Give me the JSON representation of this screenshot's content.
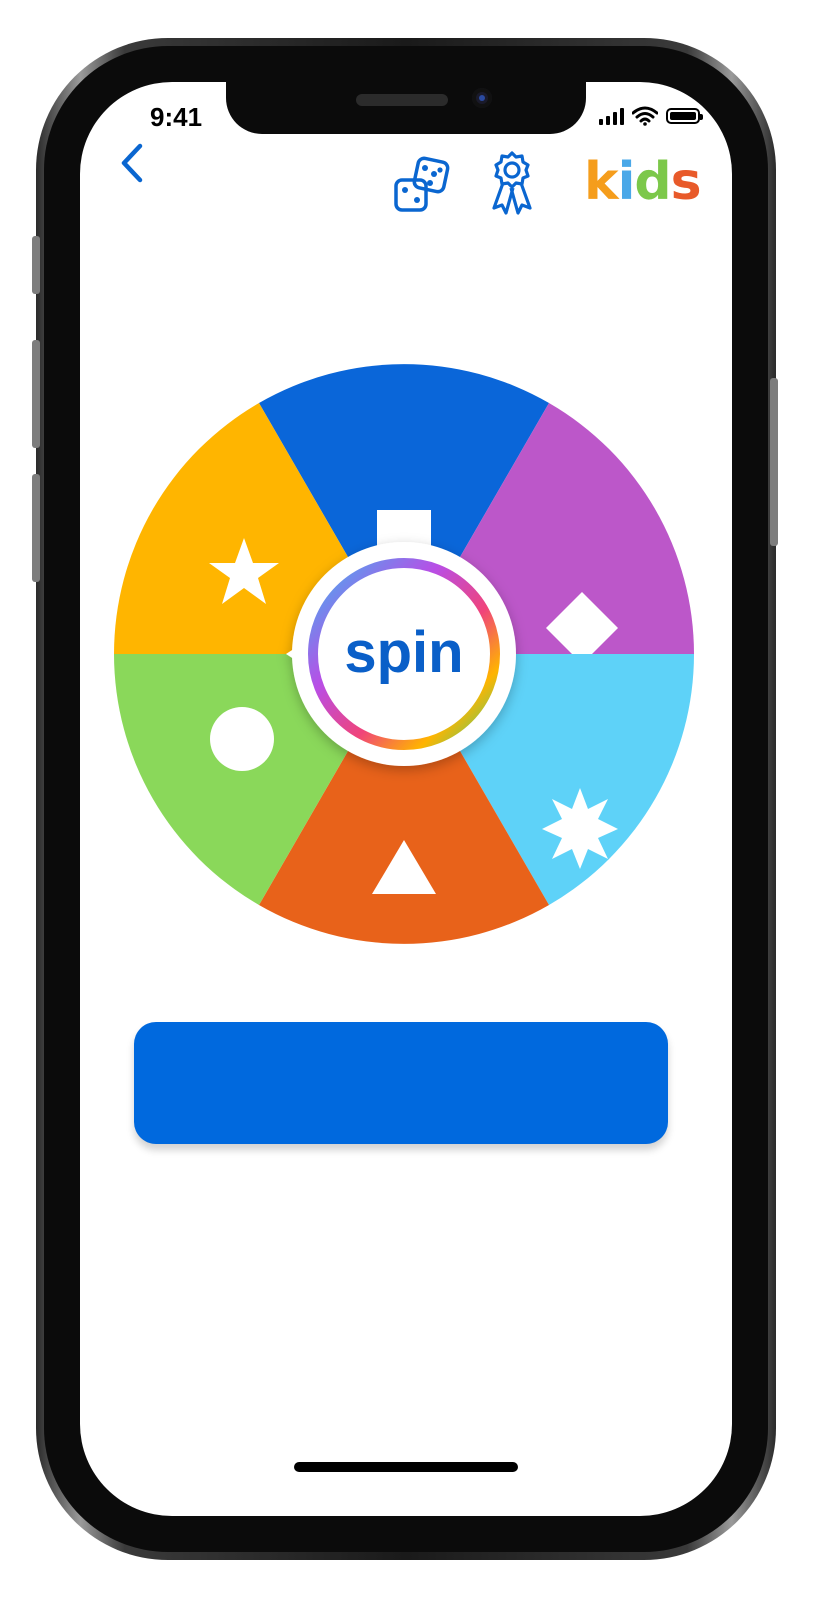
{
  "status_bar": {
    "time": "9:41",
    "signal_icon": "cellular-signal-icon",
    "wifi_icon": "wifi-icon",
    "battery_icon": "battery-icon"
  },
  "header": {
    "back_icon": "chevron-left-icon",
    "dice_icon": "dice-icon",
    "award_icon": "award-ribbon-icon",
    "logo": {
      "letters": [
        "k",
        "i",
        "d",
        "s"
      ],
      "colors": [
        "#f59d1c",
        "#4aa8e8",
        "#7cc84a",
        "#e85a2a"
      ]
    },
    "accent_color": "#0a66d0"
  },
  "wheel": {
    "center_label": "spin",
    "segments": [
      {
        "shape": "square",
        "color": "#0a66d9"
      },
      {
        "shape": "diamond",
        "color": "#bc57c9"
      },
      {
        "shape": "burst",
        "color": "#5ed2f8"
      },
      {
        "shape": "triangle",
        "color": "#e8621a"
      },
      {
        "shape": "circle",
        "color": "#8ad85a"
      },
      {
        "shape": "star",
        "color": "#ffb500"
      }
    ]
  },
  "action_button": {
    "label": "",
    "color": "#0069de"
  }
}
